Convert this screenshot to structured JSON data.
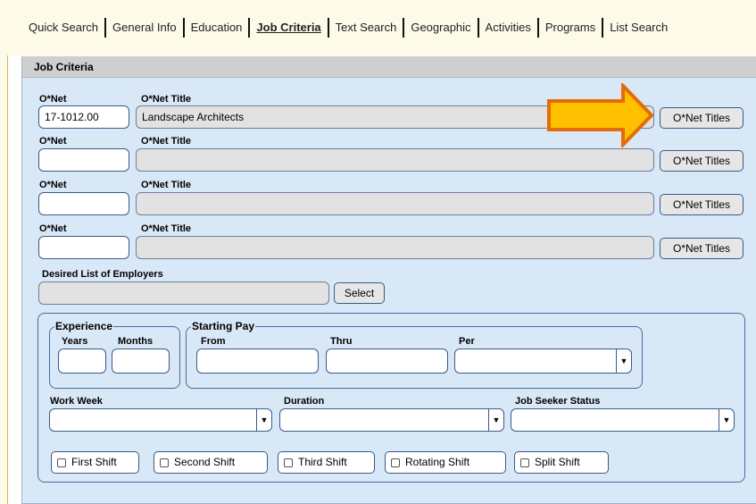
{
  "tabs": [
    {
      "label": "Quick Search",
      "active": false
    },
    {
      "label": "General Info",
      "active": false
    },
    {
      "label": "Education",
      "active": false
    },
    {
      "label": "Job Criteria",
      "active": true
    },
    {
      "label": "Text Search",
      "active": false
    },
    {
      "label": "Geographic",
      "active": false
    },
    {
      "label": "Activities",
      "active": false
    },
    {
      "label": "Programs",
      "active": false
    },
    {
      "label": "List Search",
      "active": false
    }
  ],
  "panel": {
    "title": "Job Criteria",
    "onet_rows": [
      {
        "code_label": "O*Net",
        "title_label": "O*Net Title",
        "code_value": "17-1012.00",
        "title_value": "Landscape Architects",
        "button": "O*Net Titles"
      },
      {
        "code_label": "O*Net",
        "title_label": "O*Net Title",
        "code_value": "",
        "title_value": "",
        "button": "O*Net Titles"
      },
      {
        "code_label": "O*Net",
        "title_label": "O*Net Title",
        "code_value": "",
        "title_value": "",
        "button": "O*Net Titles"
      },
      {
        "code_label": "O*Net",
        "title_label": "O*Net Title",
        "code_value": "",
        "title_value": "",
        "button": "O*Net Titles"
      }
    ],
    "employers": {
      "label": "Desired List of Employers",
      "value": "",
      "button": "Select"
    },
    "experience": {
      "legend": "Experience",
      "years_label": "Years",
      "months_label": "Months"
    },
    "starting_pay": {
      "legend": "Starting Pay",
      "from_label": "From",
      "thru_label": "Thru",
      "per_label": "Per"
    },
    "work_week_label": "Work Week",
    "duration_label": "Duration",
    "job_seeker_status_label": "Job Seeker Status",
    "shifts": [
      "First Shift",
      "Second Shift",
      "Third Shift",
      "Rotating Shift",
      "Split Shift"
    ]
  },
  "colors": {
    "panel_bg": "#d9e8f7",
    "header_bg": "#cfcfcf",
    "arrow_fill": "#ffc000",
    "arrow_stroke": "#e46c0a"
  },
  "icons": {
    "dropdown": "chevron-down-icon",
    "annotation": "arrow-right-icon"
  }
}
